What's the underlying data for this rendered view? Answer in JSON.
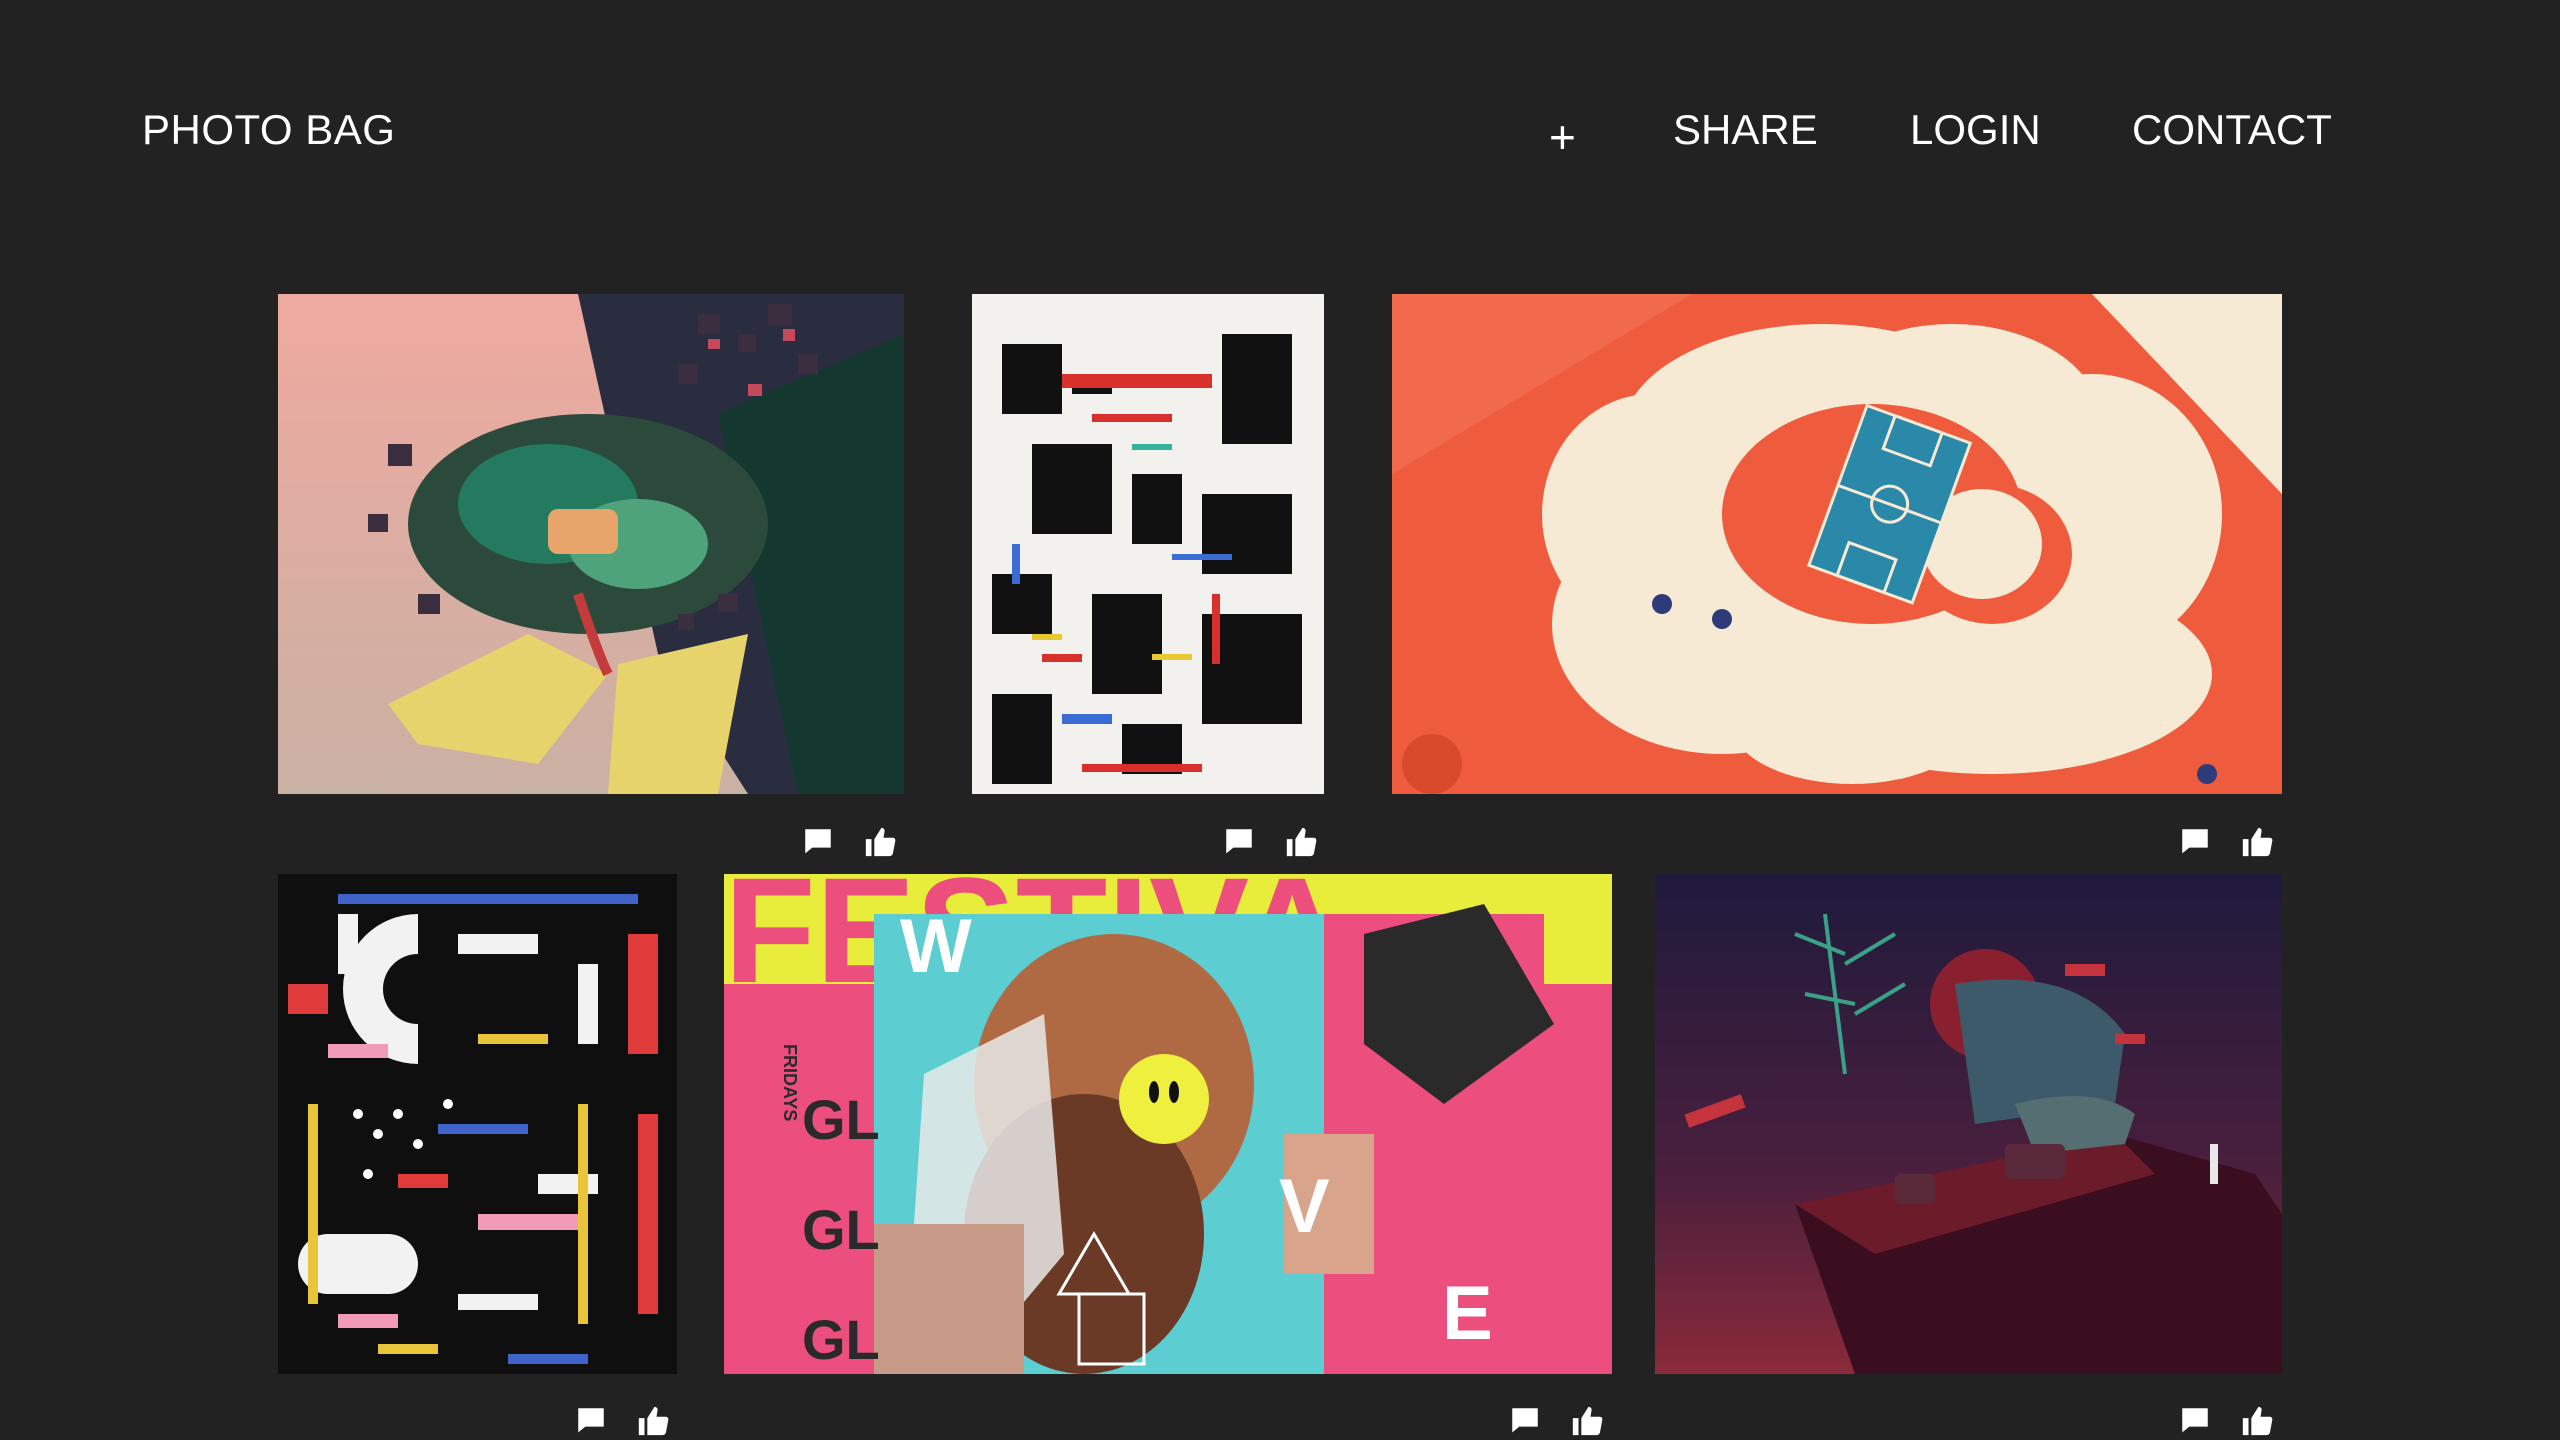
{
  "header": {
    "logo": "PHOTO BAG",
    "nav": {
      "add": "+",
      "share": "SHARE",
      "login": "LOGIN",
      "contact": "CONTACT"
    }
  },
  "gallery": {
    "items": [
      {
        "artwork": "collage floating island with plants and cubes on pink and dark green"
      },
      {
        "artwork": "black and white abstract typographic ink poster"
      },
      {
        "artwork": "orange illustration with basketball court and cream smoke cloud"
      },
      {
        "artwork": "colorful abstract paint strokes and letters on black"
      },
      {
        "poster_big_text": "FESTIVA",
        "poster_side_label": "FRIDAYS",
        "poster_rows": [
          "GL",
          "GL",
          "GL"
        ],
        "poster_letters": [
          "W",
          "V",
          "E"
        ]
      },
      {
        "artwork": "dark purple 3D collage with palm trees, cars and sneaker"
      }
    ],
    "action_icons": [
      "comment-icon",
      "thumbs-up-icon"
    ]
  },
  "colors": {
    "background": "#222222",
    "text": "#ffffff"
  }
}
